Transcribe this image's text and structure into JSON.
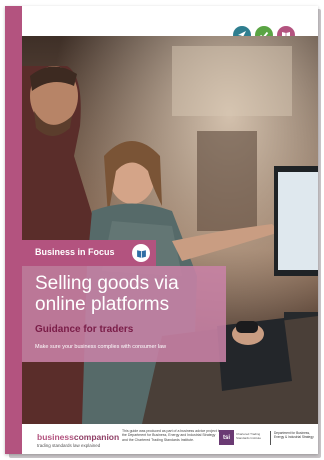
{
  "cover": {
    "icons": [
      "navigation-arrow-icon",
      "checkmark-icon",
      "book-icon"
    ],
    "icon_colors": {
      "navigation": "#2f7e8f",
      "check": "#5aa444",
      "book": "#b3537f"
    },
    "brand_color": "#b3537f",
    "series_tag": "Business in Focus",
    "title": "Selling goods via online platforms",
    "subtitle": "Guidance for traders",
    "tagline": "Make sure your business complies with consumer law"
  },
  "footer": {
    "brand_part1": "business",
    "brand_part2": "companion",
    "brand_tagline": "trading standards law explained",
    "note": "This guide was produced as part of a business advice project by the Department for Business, Energy and Industrial Strategy and the Chartered Trading Standards Institute.",
    "tsi_mark": "tsi",
    "tsi_text": "Chartered Trading Standards Institute",
    "dept_text": "Department for Business, Energy & Industrial Strategy"
  }
}
